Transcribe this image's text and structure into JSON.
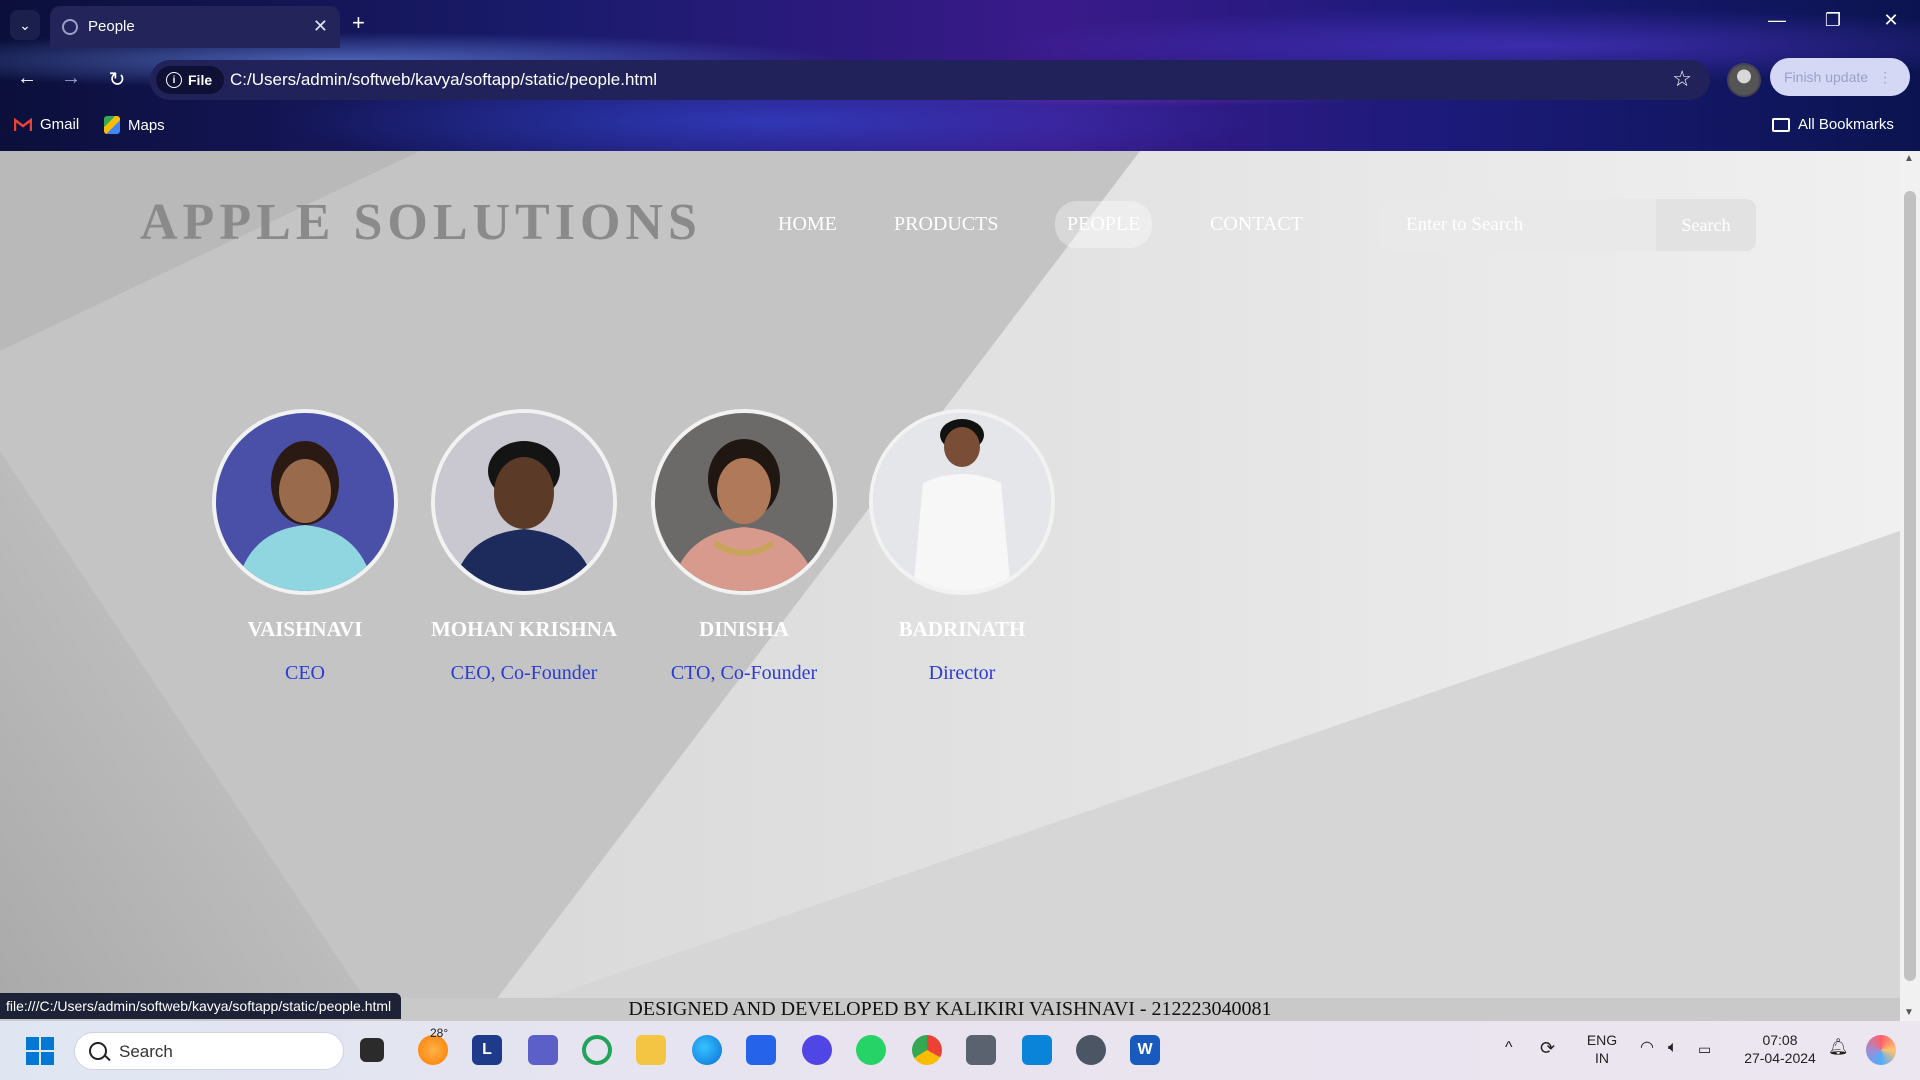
{
  "browser": {
    "tab_title": "People",
    "new_tab": "+",
    "chip_label": "File",
    "url": "C:/Users/admin/softweb/kavya/softapp/static/people.html",
    "finish_update": "Finish update",
    "bookmarks": [
      {
        "label": "Gmail",
        "icon": "gmail-icon"
      },
      {
        "label": "Maps",
        "icon": "maps-icon"
      }
    ],
    "all_bookmarks": "All Bookmarks",
    "status_url": "file:///C:/Users/admin/softweb/kavya/softapp/static/people.html"
  },
  "site": {
    "brand": "APPLE SOLUTIONS",
    "nav": [
      {
        "label": "HOME",
        "active": false
      },
      {
        "label": "PRODUCTS",
        "active": false
      },
      {
        "label": "PEOPLE",
        "active": true
      },
      {
        "label": "CONTACT",
        "active": false
      }
    ],
    "search": {
      "placeholder": "Enter to Search",
      "button": "Search"
    },
    "people": [
      {
        "name": "VAISHNAVI",
        "role": "CEO"
      },
      {
        "name": "MOHAN KRISHNA",
        "role": "CEO, Co-Founder"
      },
      {
        "name": "DINISHA",
        "role": "CTO, Co-Founder"
      },
      {
        "name": "BADRINATH",
        "role": "Director"
      }
    ],
    "footer": "DESIGNED AND DEVELOPED BY KALIKIRI VAISHNAVI - 212223040081"
  },
  "taskbar": {
    "search_label": "Search",
    "weather_temp": "28°",
    "lang_top": "ENG",
    "lang_bottom": "IN",
    "time": "07:08",
    "date": "27-04-2024"
  },
  "colors": {
    "role_text": "#2b3bd6",
    "brand_text": "#8a8a8a"
  }
}
